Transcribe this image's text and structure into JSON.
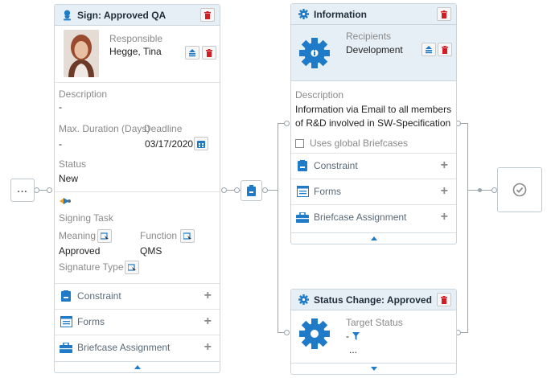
{
  "start_node": {
    "label": "..."
  },
  "sign_card": {
    "title": "Sign: Approved QA",
    "responsible_label": "Responsible",
    "responsible_value": "Hegge, Tina",
    "description_label": "Description",
    "description_value": "-",
    "duration_label": "Max. Duration (Days)",
    "duration_value": "-",
    "deadline_label": "Deadline",
    "deadline_value": "03/17/2020",
    "status_label": "Status",
    "status_value": "New",
    "signing_task_label": "Signing Task",
    "meaning_label": "Meaning",
    "meaning_value": "Approved",
    "function_label": "Function",
    "function_value": "QMS",
    "signature_type_label": "Signature Type",
    "sections": [
      {
        "label": "Constraint"
      },
      {
        "label": "Forms"
      },
      {
        "label": "Briefcase Assignment"
      }
    ]
  },
  "info_card": {
    "title": "Information",
    "recipients_label": "Recipients",
    "recipients_value": "Development",
    "description_label": "Description",
    "description_value": "Information via Email to all members of R&D involved in SW-Specification",
    "global_briefcases_label": "Uses global Briefcases",
    "sections": [
      {
        "label": "Constraint"
      },
      {
        "label": "Forms"
      },
      {
        "label": "Briefcase Assignment"
      }
    ]
  },
  "status_card": {
    "title": "Status Change: Approved",
    "target_status_label": "Target Status",
    "target_status_value": "-",
    "more": "..."
  },
  "colors": {
    "header_bg": "#e7eff6",
    "delete_red": "#d31c24",
    "action_blue": "#1f7bc8",
    "connector_gray": "#9aa4ab"
  }
}
